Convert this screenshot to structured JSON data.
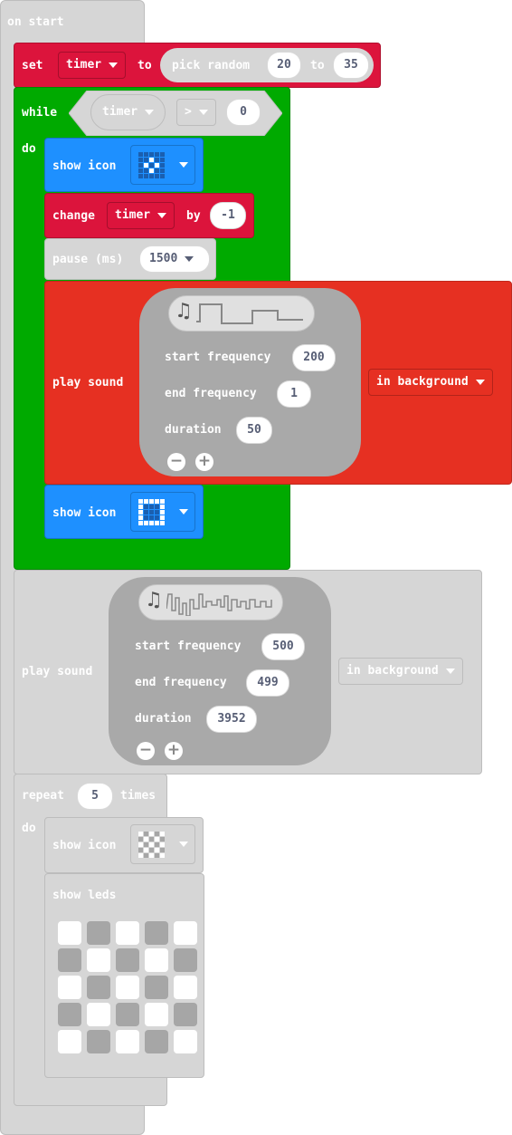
{
  "on_start": {
    "label": "on start"
  },
  "set_block": {
    "set_label": "set",
    "variable": "timer",
    "to_label": "to",
    "pick_random_label": "pick random",
    "from": "20",
    "to_word": "to",
    "to_value": "35"
  },
  "while_block": {
    "while_label": "while",
    "variable": "timer",
    "operator": ">",
    "value": "0",
    "do_label": "do"
  },
  "show_icon_1": {
    "label": "show icon",
    "icon": "small-diamond"
  },
  "change_block": {
    "change_label": "change",
    "variable": "timer",
    "by_label": "by",
    "value": "-1"
  },
  "pause_block": {
    "label": "pause (ms)",
    "value": "1500"
  },
  "play_sound_1": {
    "label": "play sound",
    "start_frequency_label": "start frequency",
    "start_frequency": "200",
    "end_frequency_label": "end frequency",
    "end_frequency": "1",
    "duration_label": "duration",
    "duration": "50",
    "mode": "in background"
  },
  "show_icon_2": {
    "label": "show icon",
    "icon": "square"
  },
  "play_sound_2": {
    "label": "play sound",
    "start_frequency_label": "start frequency",
    "start_frequency": "500",
    "end_frequency_label": "end frequency",
    "end_frequency": "499",
    "duration_label": "duration",
    "duration": "3952",
    "mode": "in background"
  },
  "repeat_block": {
    "repeat_label": "repeat",
    "times": "5",
    "times_label": "times",
    "do_label": "do"
  },
  "show_icon_3": {
    "label": "show icon",
    "icon": "chessboard"
  },
  "show_leds": {
    "label": "show leds",
    "leds": [
      [
        0,
        1,
        0,
        1,
        0
      ],
      [
        1,
        0,
        1,
        0,
        1
      ],
      [
        0,
        1,
        0,
        1,
        0
      ],
      [
        1,
        0,
        1,
        0,
        1
      ],
      [
        0,
        1,
        0,
        1,
        0
      ]
    ]
  },
  "colors": {
    "basic_blue": "#1e90ff",
    "variables_red": "#dc143c",
    "loops_green": "#00aa00",
    "music_red": "#e63022",
    "disabled_gray": "#d0d0d0"
  }
}
